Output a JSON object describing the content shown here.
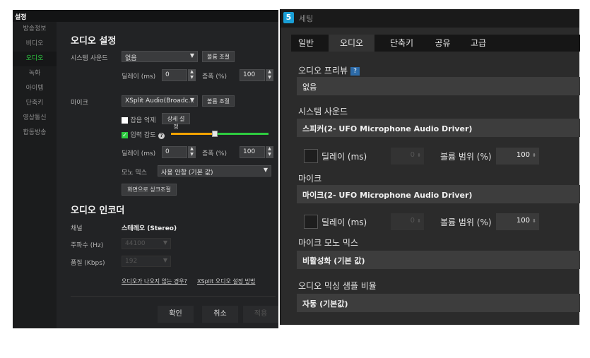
{
  "left": {
    "title": "설정",
    "nav": [
      "방송정보",
      "비디오",
      "오디오",
      "녹화",
      "아이템",
      "단축키",
      "영상통신",
      "합동방송"
    ],
    "active_nav": "오디오",
    "audio_settings_title": "오디오 설정",
    "system_sound": {
      "label": "시스템 사운드",
      "value": "없음",
      "button": "볼륨 조절"
    },
    "delay_label": "딜레이 (ms)",
    "gain_label": "증폭 (%)",
    "system_delay": "0",
    "system_gain": "100",
    "mic": {
      "label": "마이크",
      "value": "XSplit Audio(Broadc...",
      "button": "볼륨 조절"
    },
    "noise_suppress": {
      "label": "잡음 억제",
      "button": "상세 설정",
      "checked": false
    },
    "input_sensitivity": {
      "label": "입력 감도",
      "checked": true,
      "help": "?"
    },
    "mic_delay": "0",
    "mic_gain": "100",
    "mono_mix": {
      "label": "모노 믹스",
      "value": "사용 안함 (기본 값)"
    },
    "sync_button": "화면으로 싱크조절",
    "encoder_title": "오디오 인코더",
    "channel": {
      "label": "채널",
      "value": "스테레오 (Stereo)"
    },
    "frequency": {
      "label": "주파수 (Hz)",
      "value": "44100"
    },
    "quality": {
      "label": "품질 (Kbps)",
      "value": "192"
    },
    "link_no_audio": "오디오가 나오지 않는 경우?",
    "link_xsplit": "XSplit 오디오 설정 방법",
    "ok": "확인",
    "cancel": "취소",
    "apply": "적용"
  },
  "right": {
    "window_title": "세팅",
    "logo": "5",
    "tabs": [
      "일반",
      "오디오",
      "단축키",
      "공유",
      "고급"
    ],
    "active_tab": "오디오",
    "preview_label": "오디오 프리뷰",
    "preview_help": "?",
    "preview_value": "없음",
    "system_sound_label": "시스템 사운드",
    "system_sound_value": "스피커(2- UFO Microphone Audio Driver)",
    "delay_label": "딜레이 (ms)",
    "volume_range_label": "볼륨 범위 (%)",
    "delay1": "0",
    "volume1": "100",
    "mic_label": "마이크",
    "mic_value": "마이크(2- UFO Microphone Audio Driver)",
    "delay2": "0",
    "volume2": "100",
    "mono_label": "마이크 모노 믹스",
    "mono_value": "비활성화 (기본 값)",
    "sample_label": "오디오 믹싱 샘플 비율",
    "sample_value": "자동 (기본값)"
  },
  "colors": {
    "accent_green": "#2ecc40",
    "slider_orange": "#f5a400",
    "logo_blue": "#1a9fd6"
  },
  "input_sensitivity_level": 0.45
}
